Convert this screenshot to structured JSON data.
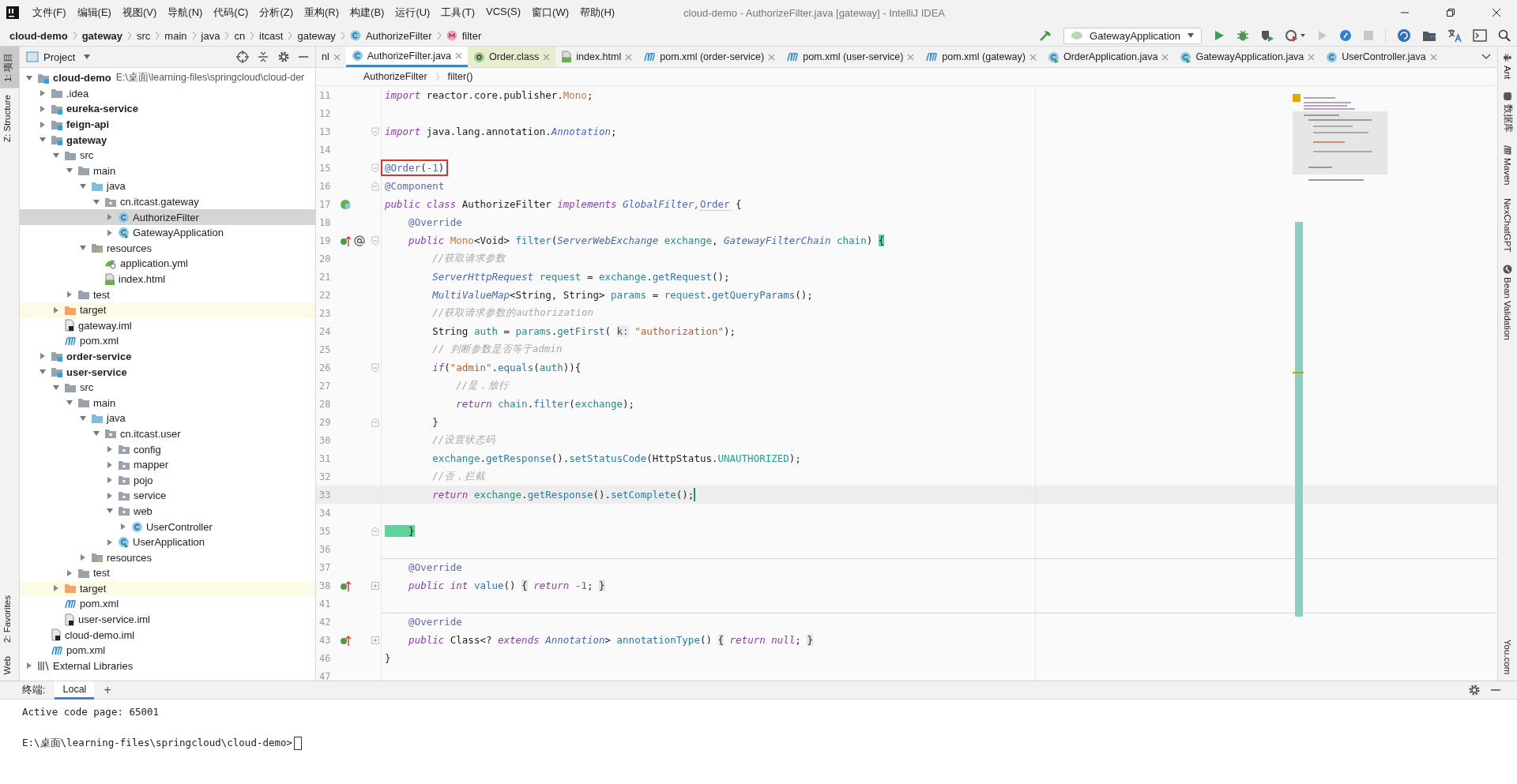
{
  "window": {
    "title": "cloud-demo - AuthorizeFilter.java [gateway] - IntelliJ IDEA"
  },
  "menu": [
    "文件(F)",
    "编辑(E)",
    "视图(V)",
    "导航(N)",
    "代码(C)",
    "分析(Z)",
    "重构(R)",
    "构建(B)",
    "运行(U)",
    "工具(T)",
    "VCS(S)",
    "窗口(W)",
    "帮助(H)"
  ],
  "breadcrumb": [
    {
      "label": "cloud-demo",
      "kind": "module"
    },
    {
      "label": "gateway",
      "kind": "module"
    },
    {
      "label": "src",
      "kind": "plain"
    },
    {
      "label": "main",
      "kind": "plain"
    },
    {
      "label": "java",
      "kind": "plain"
    },
    {
      "label": "cn",
      "kind": "plain"
    },
    {
      "label": "itcast",
      "kind": "plain"
    },
    {
      "label": "gateway",
      "kind": "plain"
    },
    {
      "label": "AuthorizeFilter",
      "kind": "class"
    },
    {
      "label": "filter",
      "kind": "method"
    }
  ],
  "run_config": "GatewayApplication",
  "left_strip": [
    {
      "label": "1: 项目",
      "selected": true
    },
    {
      "label": "Z: Structure",
      "selected": false
    }
  ],
  "left_strip_bottom": [
    {
      "label": "2: Favorites",
      "selected": false
    },
    {
      "label": "Web",
      "selected": false
    }
  ],
  "right_strip": [
    {
      "label": "Ant",
      "kind": "ant"
    },
    {
      "label": "数据库",
      "kind": "database"
    },
    {
      "label": "Maven",
      "kind": "maven"
    },
    {
      "label": "NexChatGPT",
      "kind": "plain"
    },
    {
      "label": "Bean Validation",
      "kind": "bean"
    }
  ],
  "right_strip_bottom": [
    "You.com"
  ],
  "project": {
    "title": "Project",
    "tree": [
      {
        "label": "cloud-demo",
        "kind": "module",
        "note": "E:\\桌面\\learning-files\\springcloud\\cloud-der",
        "expanded": true,
        "selected": false,
        "children": [
          {
            "label": ".idea",
            "kind": "folder",
            "expanded": false,
            "selected": false
          },
          {
            "label": "eureka-service",
            "kind": "module",
            "expanded": false,
            "selected": false
          },
          {
            "label": "feign-api",
            "kind": "module",
            "expanded": false,
            "selected": false
          },
          {
            "label": "gateway",
            "kind": "module",
            "expanded": true,
            "selected": false,
            "children": [
              {
                "label": "src",
                "kind": "folder",
                "expanded": true,
                "selected": false,
                "children": [
                  {
                    "label": "main",
                    "kind": "folder",
                    "expanded": true,
                    "selected": false,
                    "children": [
                      {
                        "label": "java",
                        "kind": "source",
                        "expanded": true,
                        "selected": false,
                        "children": [
                          {
                            "label": "cn.itcast.gateway",
                            "kind": "package",
                            "expanded": true,
                            "selected": false,
                            "children": [
                              {
                                "label": "AuthorizeFilter",
                                "kind": "class",
                                "expanded": false,
                                "selected": true
                              },
                              {
                                "label": "GatewayApplication",
                                "kind": "app",
                                "expanded": false,
                                "selected": false
                              }
                            ]
                          }
                        ]
                      },
                      {
                        "label": "resources",
                        "kind": "resources",
                        "expanded": true,
                        "selected": false,
                        "children": [
                          {
                            "label": "application.yml",
                            "kind": "yml",
                            "selected": false
                          },
                          {
                            "label": "index.html",
                            "kind": "html",
                            "selected": false
                          }
                        ]
                      }
                    ]
                  },
                  {
                    "label": "test",
                    "kind": "folder",
                    "expanded": false,
                    "selected": false
                  }
                ]
              },
              {
                "label": "target",
                "kind": "excluded",
                "expanded": false,
                "selected": false
              },
              {
                "label": "gateway.iml",
                "kind": "iml",
                "selected": false
              },
              {
                "label": "pom.xml",
                "kind": "pom",
                "selected": false
              }
            ]
          },
          {
            "label": "order-service",
            "kind": "module",
            "expanded": false,
            "selected": false
          },
          {
            "label": "user-service",
            "kind": "module",
            "expanded": true,
            "selected": false,
            "children": [
              {
                "label": "src",
                "kind": "folder",
                "expanded": true,
                "selected": false,
                "children": [
                  {
                    "label": "main",
                    "kind": "folder",
                    "expanded": true,
                    "selected": false,
                    "children": [
                      {
                        "label": "java",
                        "kind": "source",
                        "expanded": true,
                        "selected": false,
                        "children": [
                          {
                            "label": "cn.itcast.user",
                            "kind": "package",
                            "expanded": true,
                            "selected": false,
                            "children": [
                              {
                                "label": "config",
                                "kind": "package",
                                "expanded": false,
                                "selected": false
                              },
                              {
                                "label": "mapper",
                                "kind": "package",
                                "expanded": false,
                                "selected": false
                              },
                              {
                                "label": "pojo",
                                "kind": "package",
                                "expanded": false,
                                "selected": false
                              },
                              {
                                "label": "service",
                                "kind": "package",
                                "expanded": false,
                                "selected": false
                              },
                              {
                                "label": "web",
                                "kind": "package",
                                "expanded": true,
                                "selected": false,
                                "children": [
                                  {
                                    "label": "UserController",
                                    "kind": "class",
                                    "expanded": false,
                                    "selected": false
                                  }
                                ]
                              },
                              {
                                "label": "UserApplication",
                                "kind": "app",
                                "expanded": false,
                                "selected": false
                              }
                            ]
                          }
                        ]
                      },
                      {
                        "label": "resources",
                        "kind": "resources",
                        "expanded": false,
                        "selected": false
                      }
                    ]
                  },
                  {
                    "label": "test",
                    "kind": "folder",
                    "expanded": false,
                    "selected": false
                  }
                ]
              },
              {
                "label": "target",
                "kind": "excluded",
                "expanded": false,
                "selected": false
              },
              {
                "label": "pom.xml",
                "kind": "pom",
                "selected": false
              },
              {
                "label": "user-service.iml",
                "kind": "iml",
                "selected": false
              }
            ]
          },
          {
            "label": "cloud-demo.iml",
            "kind": "iml",
            "selected": false
          },
          {
            "label": "pom.xml",
            "kind": "pom",
            "selected": false
          }
        ]
      },
      {
        "label": "External Libraries",
        "kind": "library",
        "expanded": false,
        "selected": false
      }
    ]
  },
  "tabs": [
    {
      "label": "nl",
      "kind": "none",
      "selected": false
    },
    {
      "label": "AuthorizeFilter.java",
      "kind": "class",
      "selected": true
    },
    {
      "label": "Order.class",
      "kind": "annotation",
      "selected": false
    },
    {
      "label": "index.html",
      "kind": "html",
      "selected": false
    },
    {
      "label": "pom.xml (order-service)",
      "kind": "pom",
      "selected": false
    },
    {
      "label": "pom.xml (user-service)",
      "kind": "pom",
      "selected": false
    },
    {
      "label": "pom.xml (gateway)",
      "kind": "pom",
      "selected": false
    },
    {
      "label": "OrderApplication.java",
      "kind": "app",
      "selected": false
    },
    {
      "label": "GatewayApplication.java",
      "kind": "app",
      "selected": false
    },
    {
      "label": "UserController.java",
      "kind": "class",
      "selected": false
    }
  ],
  "editor_breadcrumb": [
    "AuthorizeFilter",
    "filter()"
  ],
  "code": [
    {
      "number": "11",
      "tokens": [
        {
          "kind": "kw",
          "text": "import "
        },
        {
          "kind": "p",
          "text": "reactor.core.publisher."
        },
        {
          "kind": "cls",
          "text": "Mono"
        },
        {
          "kind": "p",
          "text": ";"
        }
      ]
    },
    {
      "number": "12"
    },
    {
      "number": "13",
      "fold_marker": {
        "kind": "open"
      },
      "tokens": [
        {
          "kind": "kw",
          "text": "import "
        },
        {
          "kind": "p",
          "text": "java.lang.annotation."
        },
        {
          "kind": "type",
          "text": "Annotation"
        },
        {
          "kind": "p",
          "text": ";"
        }
      ]
    },
    {
      "number": "14"
    },
    {
      "number": "15",
      "fold_marker": {
        "kind": "open"
      },
      "boxed": true,
      "tokens": [
        {
          "kind": "ann",
          "text": "@Order"
        },
        {
          "kind": "p",
          "text": "("
        },
        {
          "kind": "ann",
          "text": "-1"
        },
        {
          "kind": "p",
          "text": ")"
        }
      ]
    },
    {
      "number": "16",
      "fold_marker": {
        "kind": "close"
      },
      "tokens": [
        {
          "kind": "ann",
          "text": "@Component"
        }
      ]
    },
    {
      "number": "17",
      "gutter_icons": [
        {
          "kind": "bean"
        }
      ],
      "tokens": [
        {
          "kind": "kw",
          "text": "public class "
        },
        {
          "kind": "p",
          "text": "AuthorizeFilter "
        },
        {
          "kind": "kw",
          "text": "implements "
        },
        {
          "kind": "type",
          "text": "GlobalFilter,"
        },
        {
          "kind": "warn",
          "text": "Order"
        },
        {
          "kind": "p",
          "text": " {"
        }
      ]
    },
    {
      "number": "18",
      "tokens": [
        {
          "kind": "ann",
          "text": "    @Override"
        }
      ]
    },
    {
      "number": "19",
      "gutter_icons": [
        {
          "kind": "implements"
        },
        {
          "kind": "at"
        }
      ],
      "fold_marker": {
        "kind": "open"
      },
      "tokens": [
        {
          "kind": "kw",
          "text": "    public "
        },
        {
          "kind": "cls",
          "text": "Mono"
        },
        {
          "kind": "p",
          "text": "<Void> "
        },
        {
          "kind": "fn",
          "text": "filter"
        },
        {
          "kind": "p",
          "text": "("
        },
        {
          "kind": "type",
          "text": "ServerWebExchange "
        },
        {
          "kind": "var",
          "text": "exchange"
        },
        {
          "kind": "p",
          "text": ", "
        },
        {
          "kind": "type",
          "text": "GatewayFilterChain "
        },
        {
          "kind": "var",
          "text": "chain"
        },
        {
          "kind": "p",
          "text": ") "
        },
        {
          "kind": "match",
          "text": "{"
        }
      ]
    },
    {
      "number": "20",
      "tokens": [
        {
          "kind": "cm",
          "text": "        //获取请求参数"
        }
      ]
    },
    {
      "number": "21",
      "tokens": [
        {
          "kind": "type",
          "text": "        ServerHttpRequest "
        },
        {
          "kind": "var",
          "text": "request"
        },
        {
          "kind": "p",
          "text": " = "
        },
        {
          "kind": "var",
          "text": "exchange"
        },
        {
          "kind": "p",
          "text": "."
        },
        {
          "kind": "fn",
          "text": "getRequest"
        },
        {
          "kind": "p",
          "text": "();"
        }
      ]
    },
    {
      "number": "22",
      "tokens": [
        {
          "kind": "type",
          "text": "        MultiValueMap"
        },
        {
          "kind": "p",
          "text": "<String, String> "
        },
        {
          "kind": "var",
          "text": "params"
        },
        {
          "kind": "p",
          "text": " = "
        },
        {
          "kind": "var",
          "text": "request"
        },
        {
          "kind": "p",
          "text": "."
        },
        {
          "kind": "fn",
          "text": "getQueryParams"
        },
        {
          "kind": "p",
          "text": "();"
        }
      ]
    },
    {
      "number": "23",
      "tokens": [
        {
          "kind": "cm",
          "text": "        //获取请求参数的authorization"
        }
      ]
    },
    {
      "number": "24",
      "tokens": [
        {
          "kind": "p",
          "text": "        String "
        },
        {
          "kind": "var",
          "text": "auth"
        },
        {
          "kind": "p",
          "text": " = "
        },
        {
          "kind": "var",
          "text": "params"
        },
        {
          "kind": "p",
          "text": "."
        },
        {
          "kind": "fn",
          "text": "getFirst"
        },
        {
          "kind": "p",
          "text": "( "
        },
        {
          "kind": "hint",
          "text": "k:"
        },
        {
          "kind": "str",
          "text": " \"authorization\""
        },
        {
          "kind": "p",
          "text": ");"
        }
      ]
    },
    {
      "number": "25",
      "tokens": [
        {
          "kind": "cm",
          "text": "        // 判断参数是否等于admin"
        }
      ]
    },
    {
      "number": "26",
      "fold_marker": {
        "kind": "open"
      },
      "tokens": [
        {
          "kind": "kw",
          "text": "        if"
        },
        {
          "kind": "p",
          "text": "("
        },
        {
          "kind": "str",
          "text": "\"admin\""
        },
        {
          "kind": "p",
          "text": "."
        },
        {
          "kind": "fn",
          "text": "equals"
        },
        {
          "kind": "p",
          "text": "("
        },
        {
          "kind": "var",
          "text": "auth"
        },
        {
          "kind": "p",
          "text": ")){"
        }
      ]
    },
    {
      "number": "27",
      "tokens": [
        {
          "kind": "cm",
          "text": "            //是，放行"
        }
      ]
    },
    {
      "number": "28",
      "tokens": [
        {
          "kind": "kw",
          "text": "            return "
        },
        {
          "kind": "var",
          "text": "chain"
        },
        {
          "kind": "p",
          "text": "."
        },
        {
          "kind": "fn",
          "text": "filter"
        },
        {
          "kind": "p",
          "text": "("
        },
        {
          "kind": "var",
          "text": "exchange"
        },
        {
          "kind": "p",
          "text": ");"
        }
      ]
    },
    {
      "number": "29",
      "fold_marker": {
        "kind": "close"
      },
      "tokens": [
        {
          "kind": "p",
          "text": "        }"
        }
      ]
    },
    {
      "number": "30",
      "tokens": [
        {
          "kind": "cm",
          "text": "        //设置状态码"
        }
      ]
    },
    {
      "number": "31",
      "tokens": [
        {
          "kind": "var",
          "text": "        exchange"
        },
        {
          "kind": "p",
          "text": "."
        },
        {
          "kind": "fn",
          "text": "getResponse"
        },
        {
          "kind": "p",
          "text": "()."
        },
        {
          "kind": "fn",
          "text": "setStatusCode"
        },
        {
          "kind": "p",
          "text": "(HttpStatus."
        },
        {
          "kind": "field",
          "text": "UNAUTHORIZED"
        },
        {
          "kind": "p",
          "text": ");"
        }
      ]
    },
    {
      "number": "32",
      "tokens": [
        {
          "kind": "cm",
          "text": "        //否，拦截"
        }
      ]
    },
    {
      "number": "33",
      "current": true,
      "tokens": [
        {
          "kind": "kw",
          "text": "        return "
        },
        {
          "kind": "var",
          "text": "exchange"
        },
        {
          "kind": "p",
          "text": "."
        },
        {
          "kind": "fn",
          "text": "getResponse"
        },
        {
          "kind": "p",
          "text": "()."
        },
        {
          "kind": "fn",
          "text": "setComplete"
        },
        {
          "kind": "p",
          "text": "();"
        }
      ]
    },
    {
      "number": "34"
    },
    {
      "number": "35",
      "fold_marker": {
        "kind": "close"
      },
      "tokens": [
        {
          "kind": "match",
          "text": "    }"
        }
      ]
    },
    {
      "number": "36"
    },
    {
      "number": "37",
      "separator": true,
      "tokens": [
        {
          "kind": "ann",
          "text": "    @Override"
        }
      ]
    },
    {
      "number": "38",
      "gutter_icons": [
        {
          "kind": "implements"
        }
      ],
      "fold_marker": {
        "kind": "collapsed"
      },
      "tokens": [
        {
          "kind": "kw",
          "text": "    public int "
        },
        {
          "kind": "fn",
          "text": "value"
        },
        {
          "kind": "p",
          "text": "() "
        },
        {
          "kind": "fold",
          "text": "{"
        },
        {
          "kind": "kw",
          "text": " return "
        },
        {
          "kind": "num",
          "text": "-1"
        },
        {
          "kind": "p",
          "text": "; "
        },
        {
          "kind": "fold",
          "text": "}"
        }
      ]
    },
    {
      "number": "41"
    },
    {
      "number": "42",
      "separator": true,
      "tokens": [
        {
          "kind": "ann",
          "text": "    @Override"
        }
      ]
    },
    {
      "number": "43",
      "gutter_icons": [
        {
          "kind": "implements"
        }
      ],
      "fold_marker": {
        "kind": "collapsed"
      },
      "tokens": [
        {
          "kind": "kw",
          "text": "    public "
        },
        {
          "kind": "p",
          "text": "Class<? "
        },
        {
          "kind": "kw",
          "text": "extends "
        },
        {
          "kind": "type",
          "text": "Annotation"
        },
        {
          "kind": "p",
          "text": "> "
        },
        {
          "kind": "fn",
          "text": "annotationType"
        },
        {
          "kind": "p",
          "text": "() "
        },
        {
          "kind": "fold",
          "text": "{"
        },
        {
          "kind": "kw",
          "text": " return null"
        },
        {
          "kind": "p",
          "text": "; "
        },
        {
          "kind": "fold",
          "text": "}"
        }
      ]
    },
    {
      "number": "46",
      "tokens": [
        {
          "kind": "p",
          "text": "}"
        }
      ]
    },
    {
      "number": "47"
    }
  ],
  "terminal": {
    "title": "终端:",
    "tabs": [
      {
        "label": "Local",
        "selected": true
      }
    ],
    "add": "+",
    "lines": [
      "Active code page: 65001",
      "E:\\桌面\\learning-files\\springcloud\\cloud-demo>"
    ]
  }
}
